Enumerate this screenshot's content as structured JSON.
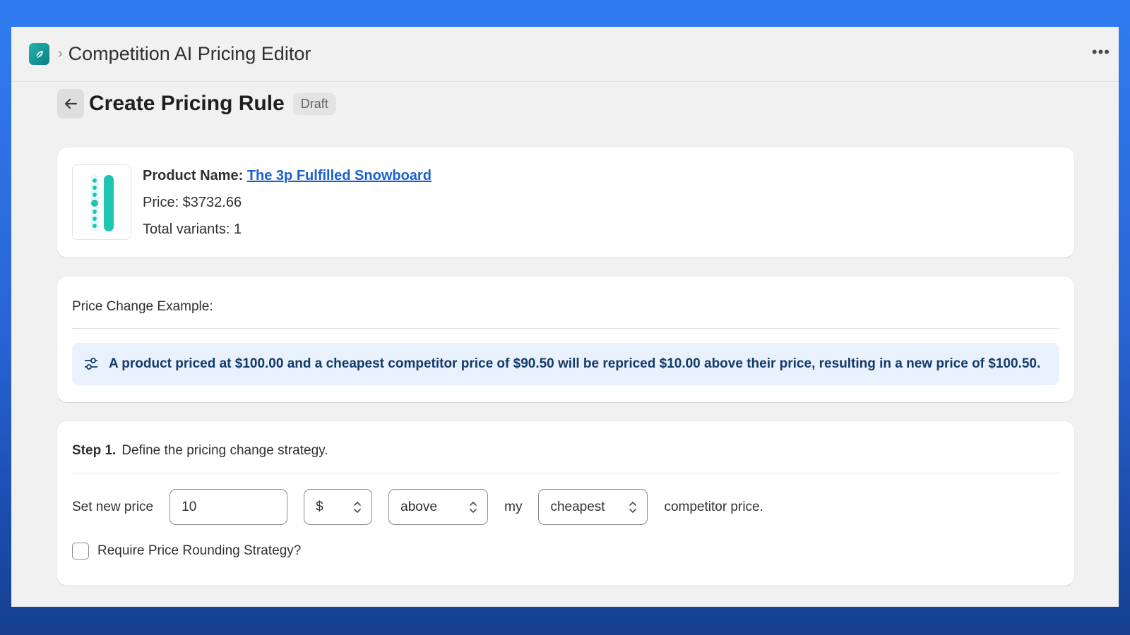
{
  "app": {
    "title": "Competition AI Pricing Editor",
    "icon": "leaf-app-icon",
    "more_label": "•••"
  },
  "page": {
    "title": "Create Pricing Rule",
    "status_badge": "Draft"
  },
  "product": {
    "name_label": "Product Name:",
    "name": "The 3p Fulfilled Snowboard",
    "price": "Price: $3732.66",
    "variants": "Total variants: 1"
  },
  "example": {
    "heading": "Price Change Example:",
    "text": "A product priced at $100.00 and a cheapest competitor price of $90.50 will be repriced $10.00 above their price, resulting in a new price of $100.50."
  },
  "step1": {
    "number": "Step 1.",
    "description": "Define the pricing change strategy.",
    "set_label": "Set new price",
    "amount_value": "10",
    "unit_value": "$",
    "direction_value": "above",
    "my_label": "my",
    "competitor_value": "cheapest",
    "suffix_label": "competitor price.",
    "rounding_label": "Require Price Rounding Strategy?",
    "rounding_checked": false
  },
  "colors": {
    "background": "#2f7cf0",
    "link": "#1a5fd1",
    "banner": "#e8f1fc",
    "accent": "#21b6a8"
  }
}
